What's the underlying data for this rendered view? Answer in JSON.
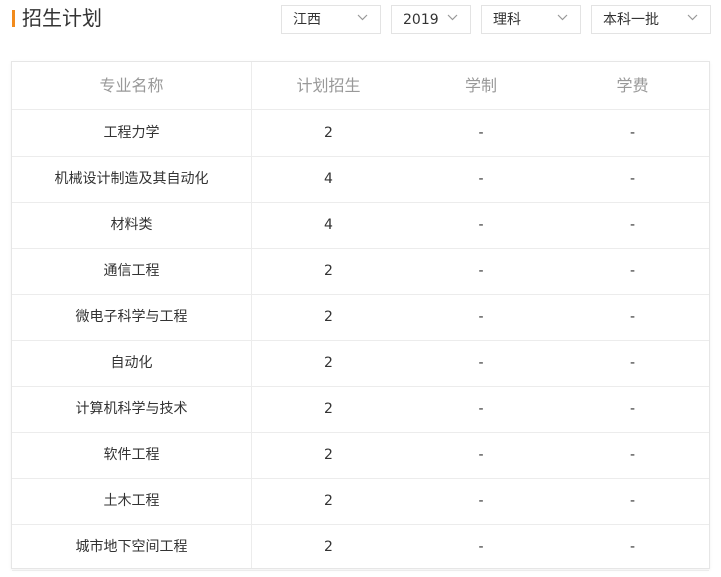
{
  "header": {
    "title": "招生计划",
    "accent_color": "#f28b1d"
  },
  "filters": {
    "province": "江西",
    "year": "2019",
    "subject_type": "理科",
    "batch": "本科一批",
    "chevron_icon": "chevron-down-icon"
  },
  "table": {
    "columns": [
      "专业名称",
      "计划招生",
      "学制",
      "学费"
    ],
    "rows": [
      {
        "major": "工程力学",
        "plan": "2",
        "duration": "-",
        "fee": "-"
      },
      {
        "major": "机械设计制造及其自动化",
        "plan": "4",
        "duration": "-",
        "fee": "-"
      },
      {
        "major": "材料类",
        "plan": "4",
        "duration": "-",
        "fee": "-"
      },
      {
        "major": "通信工程",
        "plan": "2",
        "duration": "-",
        "fee": "-"
      },
      {
        "major": "微电子科学与工程",
        "plan": "2",
        "duration": "-",
        "fee": "-"
      },
      {
        "major": "自动化",
        "plan": "2",
        "duration": "-",
        "fee": "-"
      },
      {
        "major": "计算机科学与技术",
        "plan": "2",
        "duration": "-",
        "fee": "-"
      },
      {
        "major": "软件工程",
        "plan": "2",
        "duration": "-",
        "fee": "-"
      },
      {
        "major": "土木工程",
        "plan": "2",
        "duration": "-",
        "fee": "-"
      },
      {
        "major": "城市地下空间工程",
        "plan": "2",
        "duration": "-",
        "fee": "-"
      }
    ]
  }
}
